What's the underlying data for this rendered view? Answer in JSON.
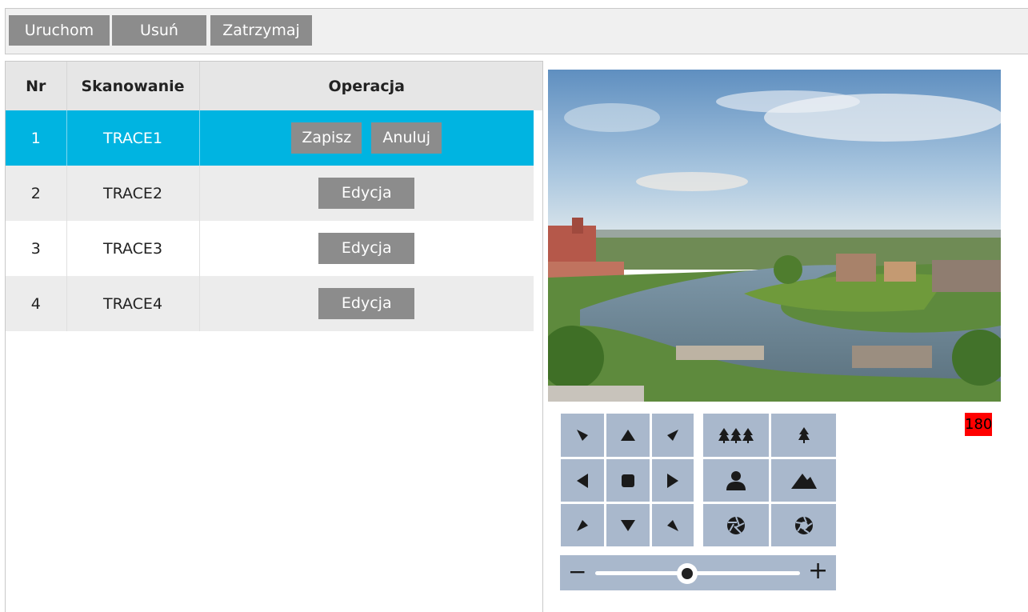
{
  "toolbar": {
    "start_label": "Uruchom",
    "delete_label": "Usuń",
    "stop_label": "Zatrzymaj"
  },
  "table": {
    "headers": [
      "Nr",
      "Skanowanie",
      "Operacja"
    ],
    "rows": [
      {
        "nr": "1",
        "name": "TRACE1",
        "save_label": "Zapisz",
        "cancel_label": "Anuluj"
      },
      {
        "nr": "2",
        "name": "TRACE2",
        "edit_label": "Edycja"
      },
      {
        "nr": "3",
        "name": "TRACE3",
        "edit_label": "Edycja"
      },
      {
        "nr": "4",
        "name": "TRACE4",
        "edit_label": "Edycja"
      }
    ]
  },
  "ptz": {
    "speed_value": "180",
    "directions": [
      "up-left",
      "up",
      "up-right",
      "left",
      "stop",
      "right",
      "down-left",
      "down",
      "down-right"
    ],
    "lens_controls": [
      "zoom-wide-icon",
      "zoom-tele-icon",
      "focus-near-icon",
      "focus-far-icon",
      "iris-close-icon",
      "iris-open-icon"
    ],
    "zoom_minus": "−",
    "zoom_plus": "+"
  },
  "colors": {
    "selected_row": "#00b4e1",
    "button_gray": "#8c8c8c",
    "ptz_pad": "#a9b8cc",
    "speed_badge": "#ff0000"
  }
}
